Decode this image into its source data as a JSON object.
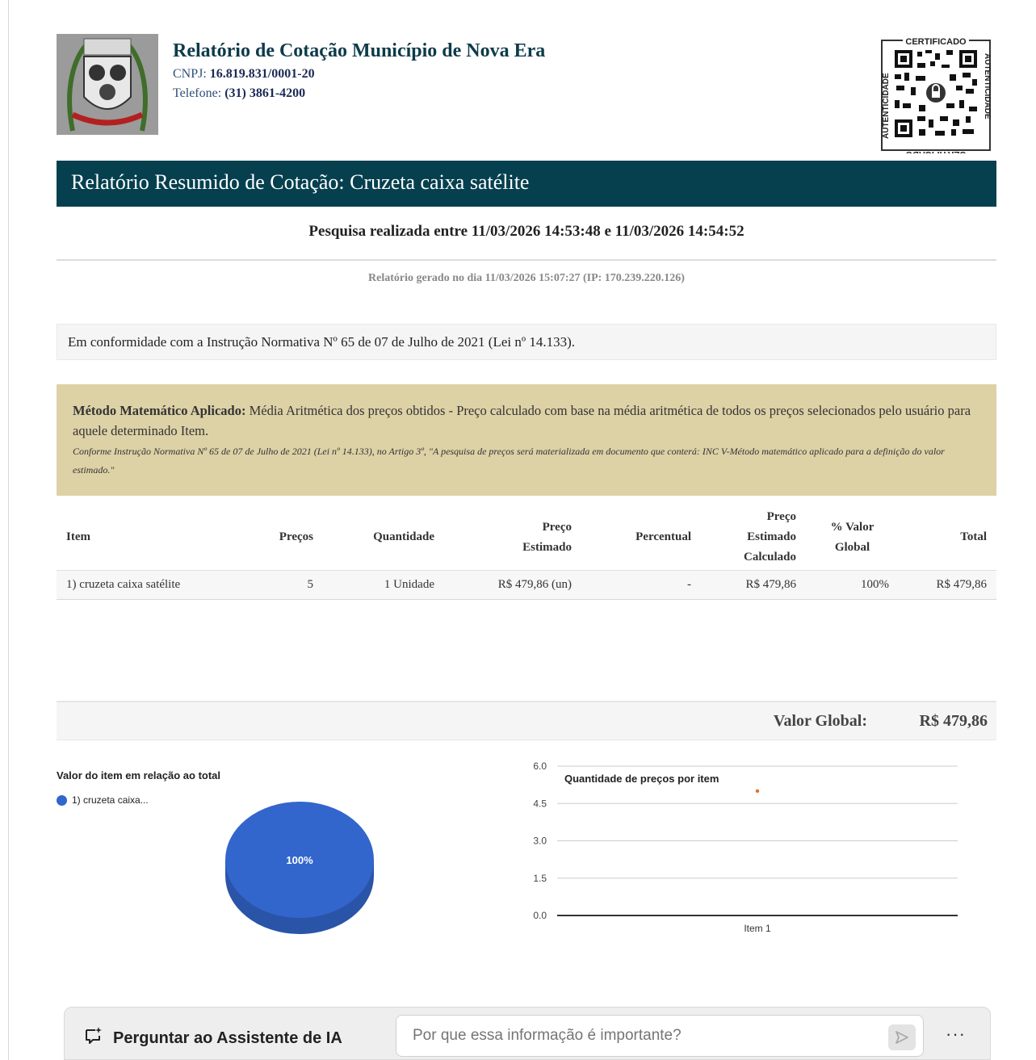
{
  "header": {
    "org_title": "Relatório de Cotação Município de Nova Era",
    "cnpj_label": "CNPJ:",
    "cnpj_value": "16.819.831/0001-20",
    "phone_label": "Telefone:",
    "phone_value": "(31) 3861-4200",
    "seal_top": "CERTIFICADO",
    "seal_side": "AUTENTICIDADE"
  },
  "banner": {
    "title": "Relatório Resumido de Cotação: Cruzeta caixa satélite"
  },
  "period": "Pesquisa realizada entre 11/03/2026 14:53:48 e 11/03/2026 14:54:52",
  "generated": "Relatório gerado no dia 11/03/2026 15:07:27    (IP: 170.239.220.126)",
  "conformity": "Em conformidade com a Instrução Normativa Nº 65 de 07 de Julho de 2021 (Lei nº 14.133).",
  "method": {
    "label": "Método Matemático Aplicado:",
    "text": " Média Aritmética dos preços obtidos - Preço calculado com base na média aritmética de todos os preços selecionados pelo usuário para aquele determinado Item.",
    "note": "Conforme Instrução Normativa Nº 65 de 07 de Julho de 2021 (Lei nº 14.133), no Artigo 3º, \"A pesquisa de preços será materializada em documento que conterá: INC V-Método matemático aplicado para a definição do valor estimado.\""
  },
  "table": {
    "headers": {
      "item": "Item",
      "precos": "Preços",
      "quantidade": "Quantidade",
      "preco_estimado_1": "Preço",
      "preco_estimado_2": "Estimado",
      "percentual": "Percentual",
      "calc_1": "Preço",
      "calc_2": "Estimado",
      "calc_3": "Calculado",
      "valor_global_1": "% Valor",
      "valor_global_2": "Global",
      "total": "Total"
    },
    "rows": [
      {
        "item": "1) cruzeta caixa satélite",
        "precos": "5",
        "quantidade": "1 Unidade",
        "preco_estimado": "R$ 479,86 (un)",
        "percentual": "-",
        "calculado": "R$ 479,86",
        "valor_global": "100%",
        "total": "R$ 479,86"
      }
    ]
  },
  "global": {
    "label": "Valor Global:",
    "value": "R$ 479,86"
  },
  "chart_data": [
    {
      "type": "pie",
      "title": "Valor do item em relação ao total",
      "categories": [
        "1) cruzeta caixa..."
      ],
      "values": [
        100
      ],
      "slice_labels": [
        "100%"
      ],
      "colors": [
        "#3366cc"
      ],
      "legend": "top-left"
    },
    {
      "type": "scatter",
      "title": "Quantidade de preços por item",
      "categories": [
        "Item 1"
      ],
      "values": [
        5
      ],
      "ylim": [
        0,
        6
      ],
      "yticks": [
        "0.0",
        "1.5",
        "3.0",
        "4.5",
        "6.0"
      ],
      "colors": [
        "#e0701e"
      ],
      "grid": true
    }
  ],
  "ai": {
    "label": "Perguntar ao Assistente de IA",
    "placeholder": "Por que essa informação é importante?",
    "more": "···"
  }
}
